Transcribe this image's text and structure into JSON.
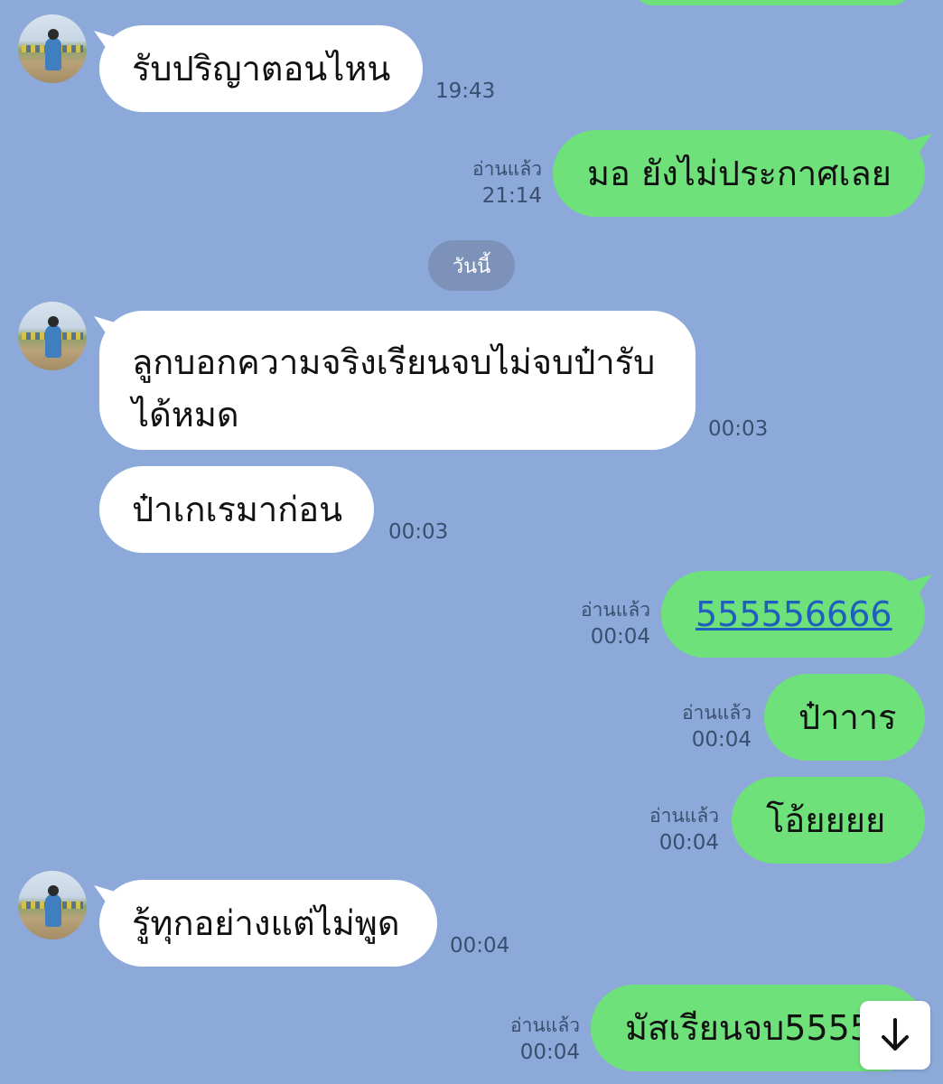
{
  "chat": {
    "read_label": "อ่านแล้ว",
    "date_separator": "วันนี้",
    "messages": [
      {
        "dir": "in",
        "text": "รับปริญาตอนไหน",
        "time": "19:43"
      },
      {
        "dir": "out",
        "text": "มอ ยังไม่ประกาศเลย",
        "time": "21:14"
      },
      {
        "dir": "in",
        "text": "ลูกบอกความจริงเรียนจบไม่จบป๋ารับได้หมด",
        "time": "00:03"
      },
      {
        "dir": "in",
        "text": "ป๋าเกเรมาก่อน",
        "time": "00:03"
      },
      {
        "dir": "out",
        "text": "555556666",
        "time": "00:04"
      },
      {
        "dir": "out",
        "text": "ป๋าาาร",
        "time": "00:04"
      },
      {
        "dir": "out",
        "text": "โอ้ยยยย",
        "time": "00:04"
      },
      {
        "dir": "in",
        "text": "รู้ทุกอย่างแต่ไม่พูด",
        "time": "00:04"
      },
      {
        "dir": "out",
        "text": "มัสเรียนจบ5555",
        "time": "00:04"
      }
    ]
  },
  "colors": {
    "background": "#8ca9d9",
    "incoming_bubble": "#ffffff",
    "outgoing_bubble": "#6fe17a",
    "link": "#1f5fbd"
  },
  "icons": {
    "scroll_down": "arrow-down-icon",
    "avatar": "contact-avatar"
  }
}
